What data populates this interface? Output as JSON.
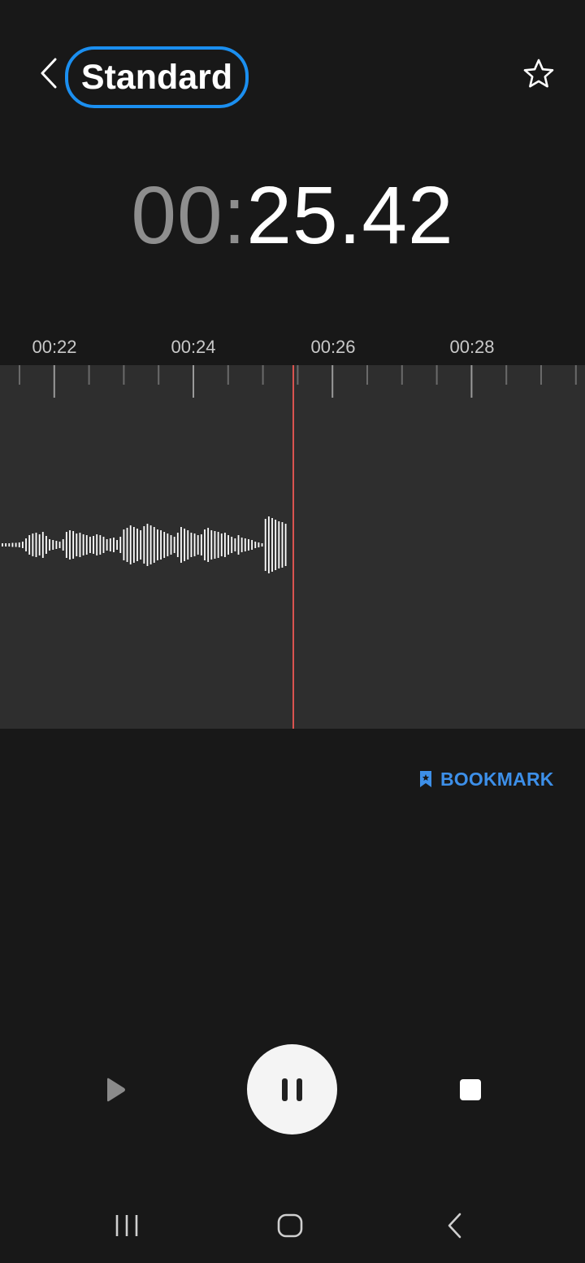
{
  "header": {
    "title": "Standard",
    "back_icon": "chevron-left-icon",
    "favorite_icon": "star-outline-icon",
    "pill_color": "#1b8ff0"
  },
  "timer": {
    "minutes": "00:",
    "seconds": "25.42"
  },
  "timeline": {
    "labels": [
      "00:22",
      "00:24",
      "00:26",
      "00:28"
    ]
  },
  "waveform": {
    "playhead_color": "#d9534f",
    "background": "#2e2e2e"
  },
  "bookmark": {
    "label": "BOOKMARK",
    "icon": "bookmark-icon",
    "color": "#3d8fe8"
  },
  "controls": {
    "play_icon": "play-icon",
    "pause_icon": "pause-icon",
    "stop_icon": "stop-icon"
  },
  "navbar": {
    "recents_icon": "recents-icon",
    "home_icon": "home-icon",
    "back_icon": "nav-back-icon"
  }
}
